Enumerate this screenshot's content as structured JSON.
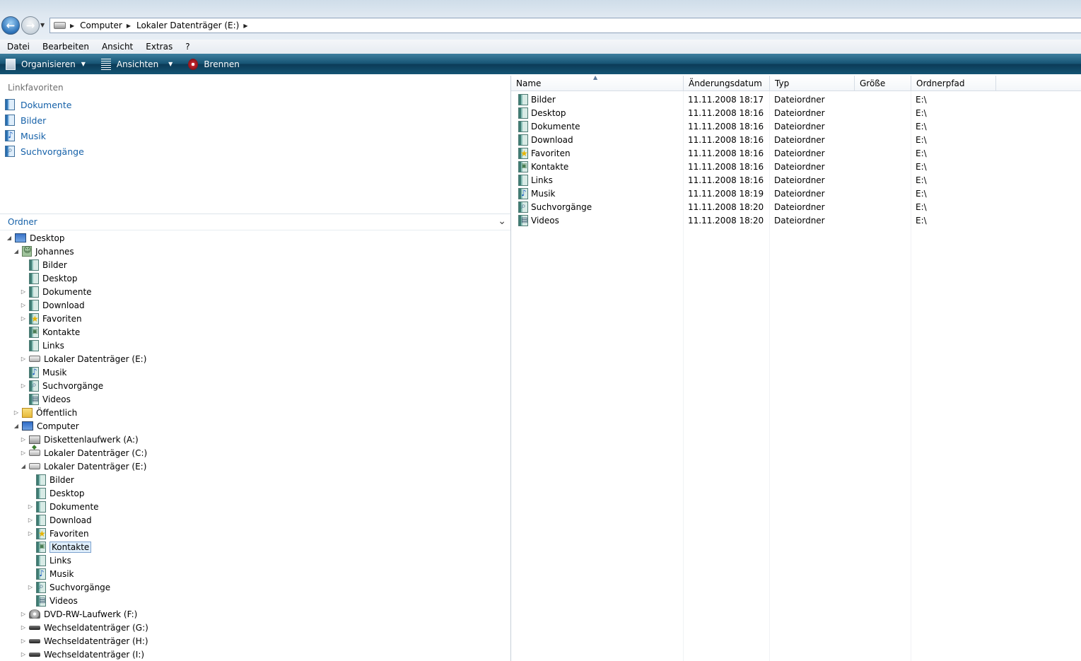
{
  "address": {
    "breadcrumbs": [
      "Computer",
      "Lokaler Datenträger (E:)"
    ]
  },
  "menu": [
    "Datei",
    "Bearbeiten",
    "Ansicht",
    "Extras",
    "?"
  ],
  "toolbar": {
    "organize": "Organisieren",
    "views": "Ansichten",
    "burn": "Brennen"
  },
  "favorites": {
    "title": "Linkfavoriten",
    "items": [
      {
        "label": "Dokumente",
        "icon": "documents-folder-icon"
      },
      {
        "label": "Bilder",
        "icon": "pictures-folder-icon"
      },
      {
        "label": "Musik",
        "icon": "music-folder-icon"
      },
      {
        "label": "Suchvorgänge",
        "icon": "searches-folder-icon"
      }
    ]
  },
  "folders_pane": {
    "title": "Ordner"
  },
  "tree": [
    {
      "label": "Desktop",
      "icon": "desktop-icon",
      "expanded": true
    },
    {
      "label": "Johannes",
      "icon": "user-folder-icon",
      "expanded": true
    },
    {
      "label": "Bilder",
      "icon": "pictures-folder-icon"
    },
    {
      "label": "Desktop",
      "icon": "desktop-folder-icon"
    },
    {
      "label": "Dokumente",
      "icon": "documents-folder-icon",
      "collapsed": true
    },
    {
      "label": "Download",
      "icon": "download-folder-icon",
      "collapsed": true
    },
    {
      "label": "Favoriten",
      "icon": "favorites-folder-icon",
      "collapsed": true
    },
    {
      "label": "Kontakte",
      "icon": "contacts-folder-icon"
    },
    {
      "label": "Links",
      "icon": "links-folder-icon"
    },
    {
      "label": "Lokaler Datenträger (E:)",
      "icon": "drive-icon",
      "collapsed": true
    },
    {
      "label": "Musik",
      "icon": "music-folder-icon"
    },
    {
      "label": "Suchvorgänge",
      "icon": "searches-folder-icon",
      "collapsed": true
    },
    {
      "label": "Videos",
      "icon": "videos-folder-icon"
    },
    {
      "label": "Öffentlich",
      "icon": "public-folder-icon",
      "collapsed": true
    },
    {
      "label": "Computer",
      "icon": "computer-icon",
      "expanded": true
    },
    {
      "label": "Diskettenlaufwerk (A:)",
      "icon": "floppy-drive-icon",
      "collapsed": true
    },
    {
      "label": "Lokaler Datenträger (C:)",
      "icon": "system-drive-icon",
      "collapsed": true
    },
    {
      "label": "Lokaler Datenträger (E:)",
      "icon": "drive-icon",
      "expanded": true
    },
    {
      "label": "Bilder",
      "icon": "pictures-folder-icon"
    },
    {
      "label": "Desktop",
      "icon": "desktop-folder-icon"
    },
    {
      "label": "Dokumente",
      "icon": "documents-folder-icon",
      "collapsed": true
    },
    {
      "label": "Download",
      "icon": "download-folder-icon",
      "collapsed": true
    },
    {
      "label": "Favoriten",
      "icon": "favorites-folder-icon",
      "collapsed": true
    },
    {
      "label": "Kontakte",
      "icon": "contacts-folder-icon",
      "selected": true
    },
    {
      "label": "Links",
      "icon": "links-folder-icon"
    },
    {
      "label": "Musik",
      "icon": "music-folder-icon"
    },
    {
      "label": "Suchvorgänge",
      "icon": "searches-folder-icon",
      "collapsed": true
    },
    {
      "label": "Videos",
      "icon": "videos-folder-icon"
    },
    {
      "label": "DVD-RW-Laufwerk (F:)",
      "icon": "dvd-drive-icon",
      "collapsed": true
    },
    {
      "label": "Wechseldatenträger (G:)",
      "icon": "removable-drive-icon",
      "collapsed": true
    },
    {
      "label": "Wechseldatenträger (H:)",
      "icon": "removable-drive-icon",
      "collapsed": true
    },
    {
      "label": "Wechseldatenträger (I:)",
      "icon": "removable-drive-icon",
      "collapsed": true
    }
  ],
  "columns": [
    "Name",
    "Änderungsdatum",
    "Typ",
    "Größe",
    "Ordnerpfad"
  ],
  "files": [
    {
      "name": "Bilder",
      "date": "11.11.2008 18:17",
      "type": "Dateiordner",
      "size": "",
      "path": "E:\\",
      "icon": "pictures-folder-icon"
    },
    {
      "name": "Desktop",
      "date": "11.11.2008 18:16",
      "type": "Dateiordner",
      "size": "",
      "path": "E:\\",
      "icon": "desktop-folder-icon"
    },
    {
      "name": "Dokumente",
      "date": "11.11.2008 18:16",
      "type": "Dateiordner",
      "size": "",
      "path": "E:\\",
      "icon": "documents-folder-icon"
    },
    {
      "name": "Download",
      "date": "11.11.2008 18:16",
      "type": "Dateiordner",
      "size": "",
      "path": "E:\\",
      "icon": "download-folder-icon"
    },
    {
      "name": "Favoriten",
      "date": "11.11.2008 18:16",
      "type": "Dateiordner",
      "size": "",
      "path": "E:\\",
      "icon": "favorites-folder-icon"
    },
    {
      "name": "Kontakte",
      "date": "11.11.2008 18:16",
      "type": "Dateiordner",
      "size": "",
      "path": "E:\\",
      "icon": "contacts-folder-icon"
    },
    {
      "name": "Links",
      "date": "11.11.2008 18:16",
      "type": "Dateiordner",
      "size": "",
      "path": "E:\\",
      "icon": "links-folder-icon"
    },
    {
      "name": "Musik",
      "date": "11.11.2008 18:19",
      "type": "Dateiordner",
      "size": "",
      "path": "E:\\",
      "icon": "music-folder-icon"
    },
    {
      "name": "Suchvorgänge",
      "date": "11.11.2008 18:20",
      "type": "Dateiordner",
      "size": "",
      "path": "E:\\",
      "icon": "searches-folder-icon"
    },
    {
      "name": "Videos",
      "date": "11.11.2008 18:20",
      "type": "Dateiordner",
      "size": "",
      "path": "E:\\",
      "icon": "videos-folder-icon"
    }
  ]
}
